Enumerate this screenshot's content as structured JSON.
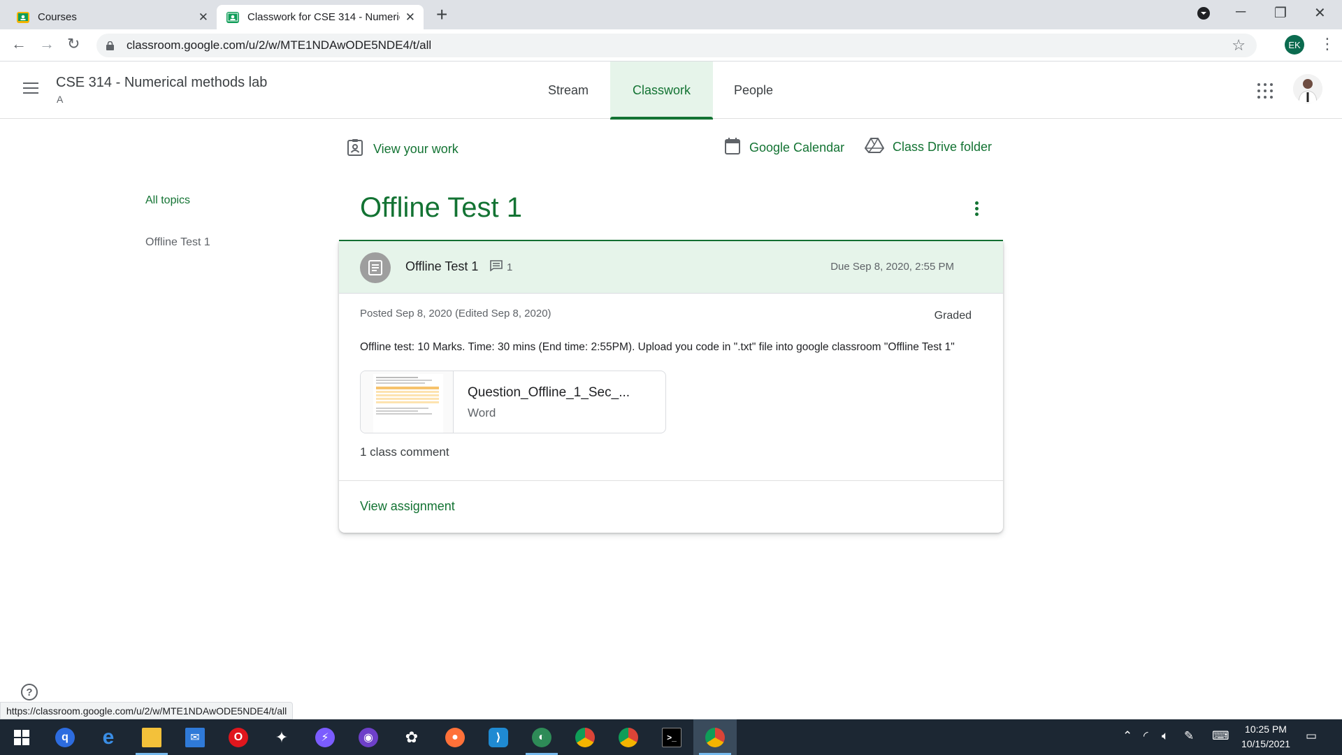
{
  "browser": {
    "tabs": [
      {
        "title": "Courses",
        "active": false
      },
      {
        "title": "Classwork for CSE 314 - Numeric",
        "active": true
      }
    ],
    "url": "classroom.google.com/u/2/w/MTE1NDAwODE5NDE4/t/all",
    "profile_initials": "EK",
    "status_url": "https://classroom.google.com/u/2/w/MTE1NDAwODE5NDE4/t/all"
  },
  "header": {
    "class_name": "CSE 314 - Numerical methods lab",
    "section": "A",
    "tabs": [
      {
        "label": "Stream"
      },
      {
        "label": "Classwork"
      },
      {
        "label": "People"
      }
    ]
  },
  "toolbar": {
    "view_work": "View your work",
    "google_calendar": "Google Calendar",
    "drive_folder": "Class Drive folder"
  },
  "topics_nav": {
    "all": "All topics",
    "items": [
      "Offline Test 1"
    ]
  },
  "topic": {
    "title": "Offline Test 1",
    "assignment": {
      "title": "Offline Test 1",
      "comment_count": "1",
      "due": "Due Sep 8, 2020, 2:55 PM",
      "posted": "Posted Sep 8, 2020 (Edited Sep 8, 2020)",
      "graded": "Graded",
      "instructions": "Offline test: 10 Marks. Time: 30 mins (End time: 2:55PM). Upload you code in \".txt\" file into google classroom \"Offline Test 1\"",
      "attachment": {
        "name": "Question_Offline_1_Sec_...",
        "type": "Word"
      },
      "class_comments": "1 class comment",
      "view_link": "View assignment"
    }
  },
  "taskbar": {
    "time": "10:25 PM",
    "date": "10/15/2021"
  },
  "colors": {
    "accent": "#137333",
    "accent_bg": "#e6f4ea",
    "taskbar": "#1c2733"
  }
}
